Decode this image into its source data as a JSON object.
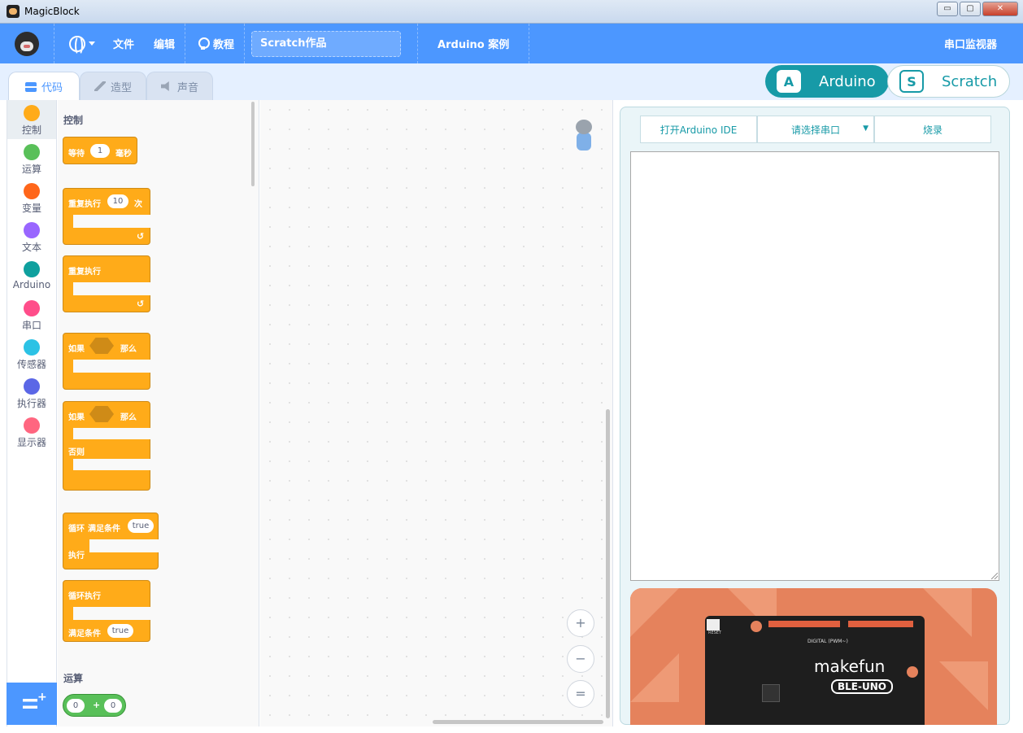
{
  "window": {
    "title": "MagicBlock",
    "controls": {
      "minimize": "▭",
      "maximize": "▢",
      "close": "✕"
    }
  },
  "menubar": {
    "file": "文件",
    "edit": "编辑",
    "tutorial": "教程",
    "project_title": "Scratch作品",
    "arduino_examples": "Arduino 案例",
    "serial_monitor": "串口监视器"
  },
  "tabs": [
    {
      "label": "代码",
      "icon": "code-icon"
    },
    {
      "label": "造型",
      "icon": "brush-icon"
    },
    {
      "label": "声音",
      "icon": "sound-icon"
    }
  ],
  "mode_switch": {
    "arduino": {
      "badge": "A",
      "label": "Arduino"
    },
    "scratch": {
      "badge": "S",
      "label": "Scratch"
    }
  },
  "categories": [
    {
      "label": "控制",
      "color": "#ffab19"
    },
    {
      "label": "运算",
      "color": "#59c059"
    },
    {
      "label": "变量",
      "color": "#ff661a"
    },
    {
      "label": "文本",
      "color": "#9966ff"
    },
    {
      "label": "Arduino",
      "color": "#0fa09e"
    },
    {
      "label": "串口",
      "color": "#ff4d8a"
    },
    {
      "label": "传感器",
      "color": "#2cc2e5"
    },
    {
      "label": "执行器",
      "color": "#5b67e6"
    },
    {
      "label": "显示器",
      "color": "#ff6680"
    }
  ],
  "flyout": {
    "section_control": "控制",
    "wait": {
      "label": "等待",
      "value": "1",
      "unit": "毫秒"
    },
    "repeat": {
      "label": "重复执行",
      "value": "10",
      "unit": "次"
    },
    "forever": {
      "label": "重复执行"
    },
    "if_then": {
      "if": "如果",
      "then": "那么"
    },
    "if_else": {
      "if": "如果",
      "then": "那么",
      "else": "否则"
    },
    "while_loop": {
      "loop": "循环",
      "cond": "满足条件",
      "value": "true",
      "do": "执行"
    },
    "do_while": {
      "loop": "循环执行",
      "cond": "满足条件",
      "value": "true"
    },
    "section_operators": "运算",
    "add": {
      "a": "0",
      "op": "+",
      "b": "0"
    }
  },
  "workspace": {
    "zoom_in": "+",
    "zoom_out": "−",
    "zoom_reset": "="
  },
  "right_panel": {
    "open_ide": "打开Arduino IDE",
    "select_port": "请选择串口",
    "upload": "烧录",
    "board_brand": "makefun",
    "board_model": "BLE-UNO",
    "board_digital": "DIGITAL (PWM~)",
    "board_reset": "RESET"
  },
  "colors": {
    "accent": "#4c97ff",
    "arduino_teal": "#179aa7",
    "control_block": "#ffab19"
  }
}
